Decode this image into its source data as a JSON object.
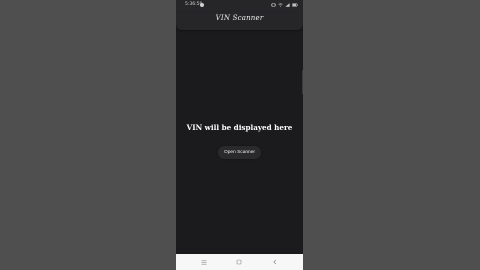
{
  "status_bar": {
    "time": "5:36:50",
    "notification_icon": "notification-dot",
    "icons": [
      "vibrate-icon",
      "wifi-icon",
      "signal-icon",
      "battery-icon"
    ]
  },
  "app_bar": {
    "title": "VIN Scanner"
  },
  "main": {
    "vin_placeholder": "VIN will be displayed here",
    "button_label": "Open Scanner"
  },
  "nav_bar": {
    "items": [
      "menu-icon",
      "home-icon",
      "back-icon"
    ]
  }
}
